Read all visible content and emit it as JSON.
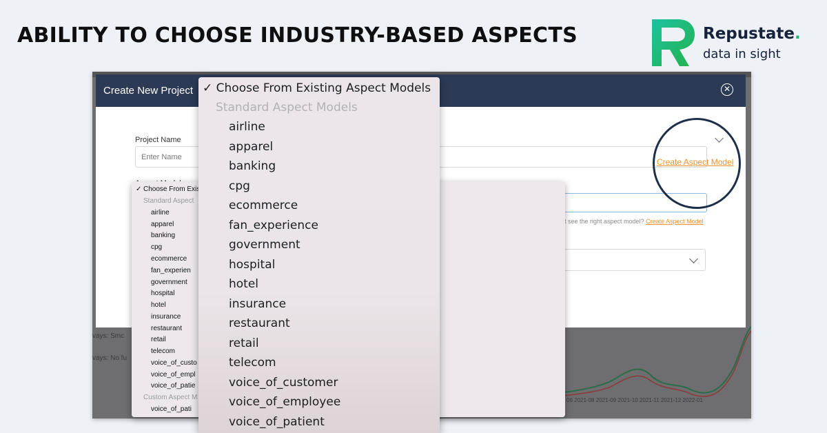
{
  "headline": "ABILITY TO CHOOSE INDUSTRY-BASED ASPECTS",
  "brand": {
    "name": "Repustate",
    "dot": ".",
    "tagline": "data in sight",
    "colors": {
      "green": "#21b573",
      "navy": "#16213a"
    }
  },
  "modal": {
    "title": "Create New Project",
    "close_icon": "close-circle-icon",
    "project_name_label": "Project Name",
    "project_name_placeholder": "Enter Name",
    "aspect_model_label": "Aspect Model",
    "helper_text": "t see the right aspect model?",
    "helper_link": "Create Aspect Model",
    "create_aspect_link": "Create Aspect Model",
    "header_color": "#2c3a56"
  },
  "dropdown_small": {
    "selected": "Choose From Exis",
    "standard_header": "Standard Aspect",
    "items": [
      "airline",
      "apparel",
      "banking",
      "cpg",
      "ecommerce",
      "fan_experien",
      "government",
      "hospital",
      "hotel",
      "insurance",
      "restaurant",
      "retail",
      "telecom",
      "voice_of_custo",
      "voice_of_empl",
      "voice_of_patie"
    ],
    "custom_header": "Custom Aspect M",
    "custom_items": [
      "voice_of_pati"
    ]
  },
  "dropdown_big": {
    "selected": "Choose From Existing Aspect Models",
    "check": "✓",
    "standard_header": "Standard Aspect Models",
    "items": [
      "airline",
      "apparel",
      "banking",
      "cpg",
      "ecommerce",
      "fan_experience",
      "government",
      "hospital",
      "hotel",
      "insurance",
      "restaurant",
      "retail",
      "telecom",
      "voice_of_customer",
      "voice_of_employee",
      "voice_of_patient"
    ]
  },
  "background": {
    "row1": "vays: Smc",
    "row2": "vays: No fu",
    "axis_ticks": "06  2021-08  2021-09  2021-10  2021-11  2021-12  2022-01"
  }
}
